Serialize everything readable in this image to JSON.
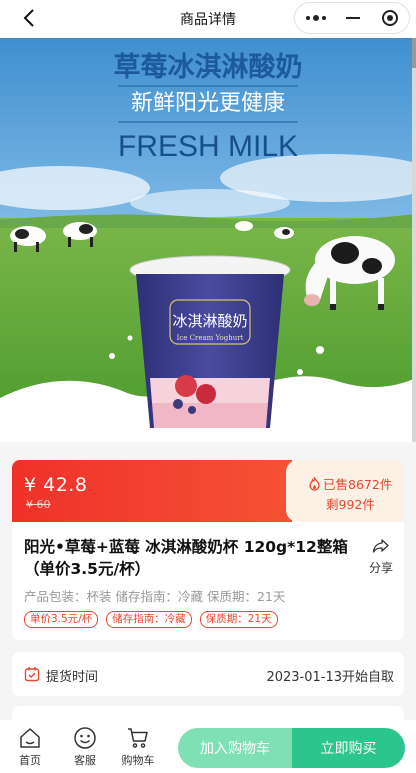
{
  "nav": {
    "title": "商品详情",
    "back_icon": "chevron-left-icon",
    "capsule_icons": [
      "more-dots-icon",
      "minimize-icon",
      "close-circle-icon"
    ]
  },
  "hero": {
    "headline": "草莓冰淇淋酸奶",
    "subline": "新鲜阳光更健康",
    "english": "FRESH MILK",
    "cup_label": "冰淇淋酸奶",
    "cup_sub": "Ice Cream Yoghurt",
    "colors": {
      "sky": "#3f8fcf",
      "grass": "#5fa83a",
      "cup": "#3e3f8e",
      "headline": "#1d5a9b"
    }
  },
  "price": {
    "current": "¥ 42.8",
    "original": "¥ 60",
    "sold": "已售8672件",
    "remaining": "剩992件",
    "fire_icon": "fire-icon",
    "colors": {
      "accent": "#f0312a",
      "badge_bg": "#fdf0e4"
    }
  },
  "product": {
    "title": "阳光•草莓+蓝莓 冰淇淋酸奶杯 120g*12整箱（单价3.5元/杯）",
    "share_label": "分享",
    "specs": "产品包装：杯装 储存指南：冷藏 保质期：21天",
    "tags": [
      "单价3.5元/杯",
      "储存指南：冷藏",
      "保质期：21天"
    ]
  },
  "pickup": {
    "label": "提货时间",
    "value": "2023-01-13开始自取"
  },
  "bottom": {
    "home": "首页",
    "service": "客服",
    "cart": "购物车",
    "add_cart": "加入购物车",
    "buy_now": "立即购买",
    "colors": {
      "add_cart": "#7fdfb5",
      "buy_now": "#2cc58d"
    }
  }
}
